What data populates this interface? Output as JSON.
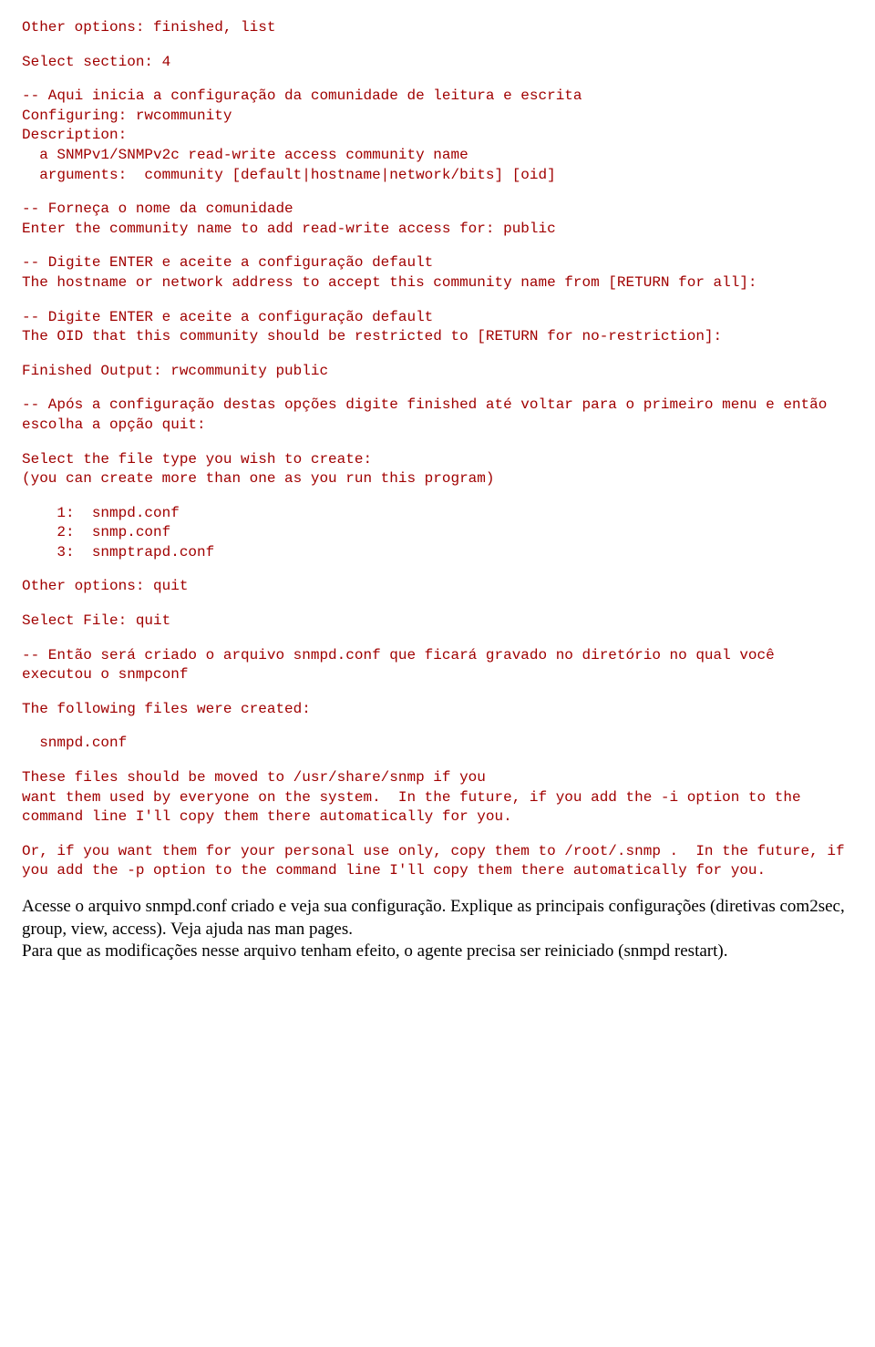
{
  "l01": "Other options: finished, list",
  "l02": "Select section: 4",
  "l03": "-- Aqui inicia a configuração da comunidade de leitura e escrita",
  "l04": "Configuring: rwcommunity",
  "l05": "Description:",
  "l06": "a SNMPv1/SNMPv2c read-write access community name",
  "l07": "arguments:  community [default|hostname|network/bits] [oid]",
  "l08": "-- Forneça o nome da comunidade",
  "l09": "Enter the community name to add read-write access for: public",
  "l10": "-- Digite ENTER e aceite a configuração default",
  "l11": "The hostname or network address to accept this community name from [RETURN for all]:",
  "l12": "-- Digite ENTER e aceite a configuração default",
  "l13": "The OID that this community should be restricted to [RETURN for no-restriction]:",
  "l14": "Finished Output: rwcommunity public",
  "l15": "-- Após a configuração destas opções digite finished até voltar para o primeiro menu e então escolha a opção quit:",
  "l16": "Select the file type you wish to create:",
  "l17": "(you can create more than one as you run this program)",
  "l18": "1:  snmpd.conf",
  "l19": "2:  snmp.conf",
  "l20": "3:  snmptrapd.conf",
  "l21": "Other options: quit",
  "l22": "Select File: quit",
  "l23": "-- Então será criado o arquivo snmpd.conf que ficará gravado no diretório no qual você executou o snmpconf",
  "l24": "The following files were created:",
  "l25": "snmpd.conf",
  "l26": "These files should be moved to /usr/share/snmp if you\nwant them used by everyone on the system.  In the future, if you add the -i option to the command line I'll copy them there automatically for you.",
  "l27": "Or, if you want them for your personal use only, copy them to /root/.snmp .  In the future, if you add the -p option to the command line I'll copy them there automatically for you.",
  "p1": "Acesse o arquivo snmpd.conf criado e veja sua configuração. Explique as principais configurações (diretivas com2sec, group, view, access). Veja ajuda nas man pages.",
  "p2": "Para que as modificações nesse arquivo tenham efeito, o agente precisa ser reiniciado (snmpd restart)."
}
